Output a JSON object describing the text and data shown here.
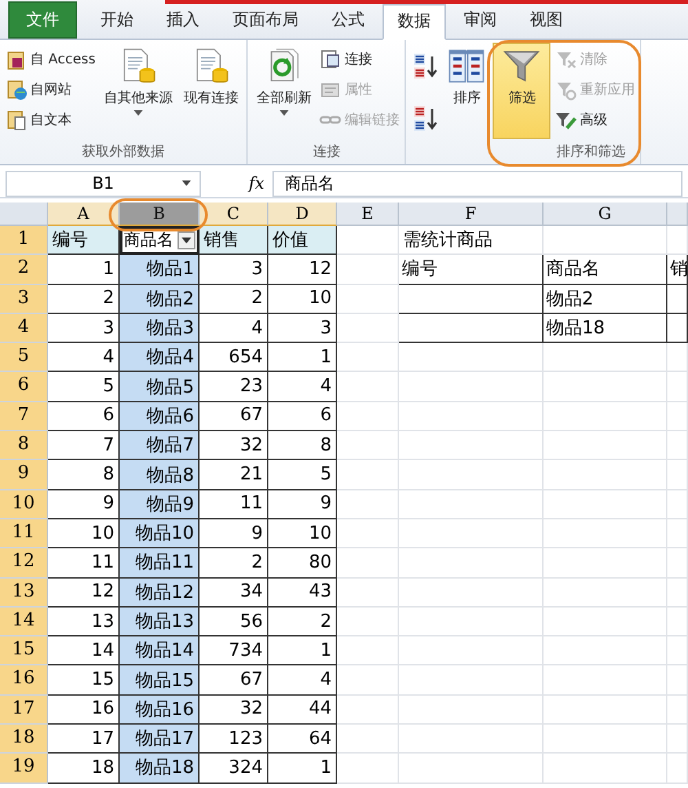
{
  "ribbon": {
    "tabs": [
      {
        "label": "文件",
        "kind": "file",
        "selected": false
      },
      {
        "label": "开始",
        "kind": "tab",
        "selected": false
      },
      {
        "label": "插入",
        "kind": "tab",
        "selected": false
      },
      {
        "label": "页面布局",
        "kind": "tab",
        "selected": false
      },
      {
        "label": "公式",
        "kind": "tab",
        "selected": false
      },
      {
        "label": "数据",
        "kind": "tab",
        "selected": true
      },
      {
        "label": "审阅",
        "kind": "tab",
        "selected": false
      },
      {
        "label": "视图",
        "kind": "tab",
        "selected": false
      }
    ],
    "groups": [
      {
        "title": "获取外部数据",
        "columns": [
          {
            "kind": "stack",
            "items": [
              {
                "label": "自 Access",
                "disabled": false
              },
              {
                "label": "自网站",
                "disabled": false
              },
              {
                "label": "自文本",
                "disabled": false
              }
            ]
          },
          {
            "kind": "large",
            "items": [
              {
                "label": "自其他来源",
                "dropdown": true,
                "selected": false
              }
            ]
          },
          {
            "kind": "large",
            "items": [
              {
                "label": "现有连接",
                "dropdown": false,
                "selected": false
              }
            ]
          }
        ]
      },
      {
        "title": "连接",
        "columns": [
          {
            "kind": "large",
            "items": [
              {
                "label": "全部刷新",
                "dropdown": true,
                "selected": false
              }
            ]
          },
          {
            "kind": "stack",
            "items": [
              {
                "label": "连接",
                "disabled": false
              },
              {
                "label": "属性",
                "disabled": true
              },
              {
                "label": "编辑链接",
                "disabled": true
              }
            ]
          }
        ]
      },
      {
        "title": "排序和筛选",
        "columns": [
          {
            "kind": "icons",
            "items": [
              {
                "disabled": false
              },
              {
                "disabled": false
              }
            ]
          },
          {
            "kind": "large",
            "items": [
              {
                "label": "排序",
                "dropdown": false,
                "selected": false
              }
            ]
          },
          {
            "kind": "large",
            "circled": true,
            "items": [
              {
                "label": "筛选",
                "dropdown": false,
                "selected": true
              }
            ]
          },
          {
            "kind": "stack",
            "items": [
              {
                "label": "清除",
                "disabled": true
              },
              {
                "label": "重新应用",
                "disabled": true
              },
              {
                "label": "高级",
                "disabled": false
              }
            ]
          }
        ]
      }
    ]
  },
  "formula_bar": {
    "name_box": "B1",
    "fx": "fx",
    "formula": "商品名"
  },
  "sheet": {
    "columns": [
      {
        "label": "A",
        "highlighted": true,
        "selected": false
      },
      {
        "label": "B",
        "highlighted": true,
        "selected": true,
        "circled": true
      },
      {
        "label": "C",
        "highlighted": true,
        "selected": false
      },
      {
        "label": "D",
        "highlighted": true,
        "selected": false
      },
      {
        "label": "E",
        "highlighted": false,
        "selected": false
      },
      {
        "label": "F",
        "highlighted": false,
        "selected": false
      },
      {
        "label": "G",
        "highlighted": false,
        "selected": false
      },
      {
        "highlighted": false,
        "selected": false
      }
    ],
    "rows": [
      {
        "label": "1",
        "highlighted": true,
        "cells": [
          {
            "kind": "heading",
            "text": "编号"
          },
          {
            "kind": "heading",
            "text": "商品名",
            "active": true,
            "filter": true
          },
          {
            "kind": "heading",
            "text": "销售"
          },
          {
            "kind": "heading",
            "text": "价值"
          },
          {
            "kind": "blank"
          },
          {
            "kind": "text",
            "text": "需统计商品"
          },
          {
            "kind": "blank"
          },
          {
            "kind": "blank"
          }
        ]
      },
      {
        "label": "2",
        "highlighted": true,
        "cells": [
          {
            "kind": "number",
            "text": "1"
          },
          {
            "kind": "item",
            "text": "物品1"
          },
          {
            "kind": "number",
            "text": "3"
          },
          {
            "kind": "number",
            "text": "12"
          },
          {
            "kind": "blank"
          },
          {
            "kind": "grid",
            "text": "编号"
          },
          {
            "kind": "grid",
            "text": "商品名"
          },
          {
            "kind": "grid",
            "text": "销"
          }
        ]
      },
      {
        "label": "3",
        "highlighted": true,
        "cells": [
          {
            "kind": "number",
            "text": "2"
          },
          {
            "kind": "item",
            "text": "物品2"
          },
          {
            "kind": "number",
            "text": "2"
          },
          {
            "kind": "number",
            "text": "10"
          },
          {
            "kind": "blank"
          },
          {
            "kind": "grid"
          },
          {
            "kind": "grid",
            "text": "物品2"
          },
          {
            "kind": "grid"
          }
        ]
      },
      {
        "label": "4",
        "highlighted": true,
        "cells": [
          {
            "kind": "number",
            "text": "3"
          },
          {
            "kind": "item",
            "text": "物品3"
          },
          {
            "kind": "number",
            "text": "4"
          },
          {
            "kind": "number",
            "text": "3"
          },
          {
            "kind": "blank"
          },
          {
            "kind": "grid"
          },
          {
            "kind": "grid",
            "text": "物品18"
          },
          {
            "kind": "grid"
          }
        ]
      },
      {
        "label": "5",
        "highlighted": true,
        "cells": [
          {
            "kind": "number",
            "text": "4"
          },
          {
            "kind": "item",
            "text": "物品4"
          },
          {
            "kind": "number",
            "text": "654"
          },
          {
            "kind": "number",
            "text": "1"
          },
          {
            "kind": "blank"
          },
          {
            "kind": "blank"
          },
          {
            "kind": "blank"
          },
          {
            "kind": "blank"
          }
        ]
      },
      {
        "label": "6",
        "highlighted": true,
        "cells": [
          {
            "kind": "number",
            "text": "5"
          },
          {
            "kind": "item",
            "text": "物品5"
          },
          {
            "kind": "number",
            "text": "23"
          },
          {
            "kind": "number",
            "text": "4"
          },
          {
            "kind": "blank"
          },
          {
            "kind": "blank"
          },
          {
            "kind": "blank"
          },
          {
            "kind": "blank"
          }
        ]
      },
      {
        "label": "7",
        "highlighted": true,
        "cells": [
          {
            "kind": "number",
            "text": "6"
          },
          {
            "kind": "item",
            "text": "物品6"
          },
          {
            "kind": "number",
            "text": "67"
          },
          {
            "kind": "number",
            "text": "6"
          },
          {
            "kind": "blank"
          },
          {
            "kind": "blank"
          },
          {
            "kind": "blank"
          },
          {
            "kind": "blank"
          }
        ]
      },
      {
        "label": "8",
        "highlighted": true,
        "cells": [
          {
            "kind": "number",
            "text": "7"
          },
          {
            "kind": "item",
            "text": "物品7"
          },
          {
            "kind": "number",
            "text": "32"
          },
          {
            "kind": "number",
            "text": "8"
          },
          {
            "kind": "blank"
          },
          {
            "kind": "blank"
          },
          {
            "kind": "blank"
          },
          {
            "kind": "blank"
          }
        ]
      },
      {
        "label": "9",
        "highlighted": true,
        "cells": [
          {
            "kind": "number",
            "text": "8"
          },
          {
            "kind": "item",
            "text": "物品8"
          },
          {
            "kind": "number",
            "text": "21"
          },
          {
            "kind": "number",
            "text": "5"
          },
          {
            "kind": "blank"
          },
          {
            "kind": "blank"
          },
          {
            "kind": "blank"
          },
          {
            "kind": "blank"
          }
        ]
      },
      {
        "label": "10",
        "highlighted": true,
        "cells": [
          {
            "kind": "number",
            "text": "9"
          },
          {
            "kind": "item",
            "text": "物品9"
          },
          {
            "kind": "number",
            "text": "11"
          },
          {
            "kind": "number",
            "text": "9"
          },
          {
            "kind": "blank"
          },
          {
            "kind": "blank"
          },
          {
            "kind": "blank"
          },
          {
            "kind": "blank"
          }
        ]
      },
      {
        "label": "11",
        "highlighted": true,
        "cells": [
          {
            "kind": "number",
            "text": "10"
          },
          {
            "kind": "item",
            "text": "物品10"
          },
          {
            "kind": "number",
            "text": "9"
          },
          {
            "kind": "number",
            "text": "10"
          },
          {
            "kind": "blank"
          },
          {
            "kind": "blank"
          },
          {
            "kind": "blank"
          },
          {
            "kind": "blank"
          }
        ]
      },
      {
        "label": "12",
        "highlighted": true,
        "cells": [
          {
            "kind": "number",
            "text": "11"
          },
          {
            "kind": "item",
            "text": "物品11"
          },
          {
            "kind": "number",
            "text": "2"
          },
          {
            "kind": "number",
            "text": "80"
          },
          {
            "kind": "blank"
          },
          {
            "kind": "blank"
          },
          {
            "kind": "blank"
          },
          {
            "kind": "blank"
          }
        ]
      },
      {
        "label": "13",
        "highlighted": true,
        "cells": [
          {
            "kind": "number",
            "text": "12"
          },
          {
            "kind": "item",
            "text": "物品12"
          },
          {
            "kind": "number",
            "text": "34"
          },
          {
            "kind": "number",
            "text": "43"
          },
          {
            "kind": "blank"
          },
          {
            "kind": "blank"
          },
          {
            "kind": "blank"
          },
          {
            "kind": "blank"
          }
        ]
      },
      {
        "label": "14",
        "highlighted": true,
        "cells": [
          {
            "kind": "number",
            "text": "13"
          },
          {
            "kind": "item",
            "text": "物品13"
          },
          {
            "kind": "number",
            "text": "56"
          },
          {
            "kind": "number",
            "text": "2"
          },
          {
            "kind": "blank"
          },
          {
            "kind": "blank"
          },
          {
            "kind": "blank"
          },
          {
            "kind": "blank"
          }
        ]
      },
      {
        "label": "15",
        "highlighted": true,
        "cells": [
          {
            "kind": "number",
            "text": "14"
          },
          {
            "kind": "item",
            "text": "物品14"
          },
          {
            "kind": "number",
            "text": "734"
          },
          {
            "kind": "number",
            "text": "1"
          },
          {
            "kind": "blank"
          },
          {
            "kind": "blank"
          },
          {
            "kind": "blank"
          },
          {
            "kind": "blank"
          }
        ]
      },
      {
        "label": "16",
        "highlighted": true,
        "cells": [
          {
            "kind": "number",
            "text": "15"
          },
          {
            "kind": "item",
            "text": "物品15"
          },
          {
            "kind": "number",
            "text": "67"
          },
          {
            "kind": "number",
            "text": "4"
          },
          {
            "kind": "blank"
          },
          {
            "kind": "blank"
          },
          {
            "kind": "blank"
          },
          {
            "kind": "blank"
          }
        ]
      },
      {
        "label": "17",
        "highlighted": true,
        "cells": [
          {
            "kind": "number",
            "text": "16"
          },
          {
            "kind": "item",
            "text": "物品16"
          },
          {
            "kind": "number",
            "text": "32"
          },
          {
            "kind": "number",
            "text": "44"
          },
          {
            "kind": "blank"
          },
          {
            "kind": "blank"
          },
          {
            "kind": "blank"
          },
          {
            "kind": "blank"
          }
        ]
      },
      {
        "label": "18",
        "highlighted": true,
        "cells": [
          {
            "kind": "number",
            "text": "17"
          },
          {
            "kind": "item",
            "text": "物品17"
          },
          {
            "kind": "number",
            "text": "123"
          },
          {
            "kind": "number",
            "text": "64"
          },
          {
            "kind": "blank"
          },
          {
            "kind": "blank"
          },
          {
            "kind": "blank"
          },
          {
            "kind": "blank"
          }
        ]
      },
      {
        "label": "19",
        "highlighted": true,
        "cells": [
          {
            "kind": "number",
            "text": "18"
          },
          {
            "kind": "item",
            "text": "物品18"
          },
          {
            "kind": "number",
            "text": "324"
          },
          {
            "kind": "number",
            "text": "1"
          },
          {
            "kind": "blank"
          },
          {
            "kind": "blank"
          },
          {
            "kind": "blank"
          },
          {
            "kind": "blank"
          }
        ]
      }
    ]
  }
}
